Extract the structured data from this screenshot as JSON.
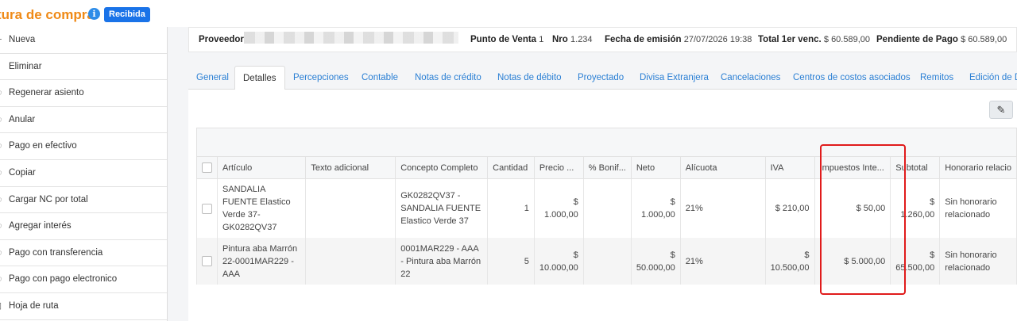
{
  "header": {
    "title": "tura de compra",
    "info_icon": "info-icon",
    "status_badge": "Recibida"
  },
  "sidebar": {
    "items": [
      {
        "label": "Nueva",
        "icon": "plus-icon"
      },
      {
        "label": "Eliminar",
        "icon": "trash-icon"
      },
      {
        "label": "Regenerar asiento",
        "icon": "refresh-icon"
      },
      {
        "label": "Anular",
        "icon": "ban-icon"
      },
      {
        "label": "Pago en efectivo",
        "icon": "cash-icon"
      },
      {
        "label": "Copiar",
        "icon": "copy-icon"
      },
      {
        "label": "Cargar NC por total",
        "icon": "credit-note-icon"
      },
      {
        "label": "Agregar interés",
        "icon": "percent-icon"
      },
      {
        "label": "Pago con transferencia",
        "icon": "transfer-icon"
      },
      {
        "label": "Pago con pago electronico",
        "icon": "card-icon"
      },
      {
        "label": "Hoja de ruta",
        "icon": "route-icon"
      }
    ]
  },
  "infobar": {
    "proveedor_label": "Proveedor",
    "punto_venta_label": "Punto de Venta",
    "punto_venta_value": "1",
    "nro_label": "Nro",
    "nro_value": "1.234",
    "fecha_label": "Fecha de emisión",
    "fecha_value": "27/07/2026 19:38",
    "total_label": "Total 1er venc.",
    "total_value": "$ 60.589,00",
    "pendiente_label": "Pendiente de Pago",
    "pendiente_value": "$ 60.589,00"
  },
  "tabs": [
    {
      "label": "General"
    },
    {
      "label": "Detalles",
      "active": true
    },
    {
      "label": "Percepciones"
    },
    {
      "label": "Contable"
    },
    {
      "label": "Notas de crédito"
    },
    {
      "label": "Notas de débito"
    },
    {
      "label": "Proyectado"
    },
    {
      "label": "Divisa Extranjera"
    },
    {
      "label": "Cancelaciones"
    },
    {
      "label": "Centros de costos asociados"
    },
    {
      "label": "Remitos"
    },
    {
      "label": "Edición de D"
    }
  ],
  "toolbar": {
    "edit_icon": "pencil-icon"
  },
  "grid": {
    "columns": [
      "Artículo",
      "Texto adicional",
      "Concepto Completo",
      "Cantidad",
      "Precio ...",
      "% Bonif...",
      "Neto",
      "Alícuota",
      "IVA",
      "Impuestos Inte...",
      "Subtotal",
      "Honorario relacio"
    ],
    "rows": [
      {
        "articulo": "SANDALIA FUENTE Elastico Verde 37-GK0282QV37",
        "texto": "",
        "concepto": "GK0282QV37 - SANDALIA FUENTE Elastico Verde 37",
        "cantidad": "1",
        "precio": "$ 1.000,00",
        "bonif": "",
        "neto": "$ 1.000,00",
        "alicuota": "21%",
        "iva": "$ 210,00",
        "impuestos": "$ 50,00",
        "subtotal": "$ 1.260,00",
        "honorario": "Sin honorario relacionado"
      },
      {
        "articulo": "Pintura aba Marrón 22-0001MAR229 - AAA",
        "texto": "",
        "concepto": "0001MAR229 - AAA - Pintura aba Marrón 22",
        "cantidad": "5",
        "precio": "$ 10.000,00",
        "bonif": "",
        "neto": "$ 50.000,00",
        "alicuota": "21%",
        "iva": "$ 10.500,00",
        "impuestos": "$ 5.000,00",
        "subtotal": "$ 65.500,00",
        "honorario": "Sin honorario relacionado"
      }
    ]
  },
  "colors": {
    "accent_orange": "#ef8a17",
    "badge_blue": "#1a73e8",
    "link_blue": "#2a7fd4",
    "highlight_red": "#e01b1b"
  }
}
